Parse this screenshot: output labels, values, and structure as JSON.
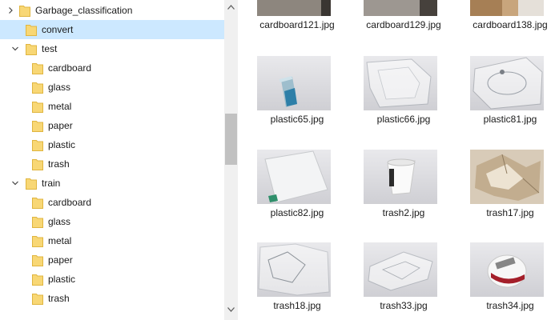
{
  "tree": {
    "items": [
      {
        "label": "Garbage_classification",
        "level": 0,
        "expander": "collapsed",
        "selected": false
      },
      {
        "label": "convert",
        "level": 1,
        "expander": "none",
        "selected": true
      },
      {
        "label": "test",
        "level": 1,
        "expander": "expanded",
        "selected": false
      },
      {
        "label": "cardboard",
        "level": 2,
        "expander": "none",
        "selected": false
      },
      {
        "label": "glass",
        "level": 2,
        "expander": "none",
        "selected": false
      },
      {
        "label": "metal",
        "level": 2,
        "expander": "none",
        "selected": false
      },
      {
        "label": "paper",
        "level": 2,
        "expander": "none",
        "selected": false
      },
      {
        "label": "plastic",
        "level": 2,
        "expander": "none",
        "selected": false
      },
      {
        "label": "trash",
        "level": 2,
        "expander": "none",
        "selected": false
      },
      {
        "label": "train",
        "level": 1,
        "expander": "expanded",
        "selected": false
      },
      {
        "label": "cardboard",
        "level": 2,
        "expander": "none",
        "selected": false
      },
      {
        "label": "glass",
        "level": 2,
        "expander": "none",
        "selected": false
      },
      {
        "label": "metal",
        "level": 2,
        "expander": "none",
        "selected": false
      },
      {
        "label": "paper",
        "level": 2,
        "expander": "none",
        "selected": false
      },
      {
        "label": "plastic",
        "level": 2,
        "expander": "none",
        "selected": false
      },
      {
        "label": "trash",
        "level": 2,
        "expander": "none",
        "selected": false
      }
    ]
  },
  "files": [
    {
      "name": "cardboard121.jpg",
      "kind": "cardboard-a"
    },
    {
      "name": "cardboard129.jpg",
      "kind": "cardboard-b"
    },
    {
      "name": "cardboard138.jpg",
      "kind": "cardboard-c"
    },
    {
      "name": "plastic65.jpg",
      "kind": "bottle-blue"
    },
    {
      "name": "plastic66.jpg",
      "kind": "clear-tray"
    },
    {
      "name": "plastic81.jpg",
      "kind": "clear-bottle"
    },
    {
      "name": "plastic82.jpg",
      "kind": "jug"
    },
    {
      "name": "trash2.jpg",
      "kind": "cup"
    },
    {
      "name": "trash17.jpg",
      "kind": "crumpled"
    },
    {
      "name": "trash18.jpg",
      "kind": "wrap"
    },
    {
      "name": "trash33.jpg",
      "kind": "bag"
    },
    {
      "name": "trash34.jpg",
      "kind": "yogurt"
    }
  ],
  "colors": {
    "selection": "#cce8ff",
    "folder": "#f8d775",
    "folder_dark": "#e0b53f",
    "scrollbar_track": "#f0f0f0",
    "scrollbar_thumb": "#c1c1c1"
  }
}
